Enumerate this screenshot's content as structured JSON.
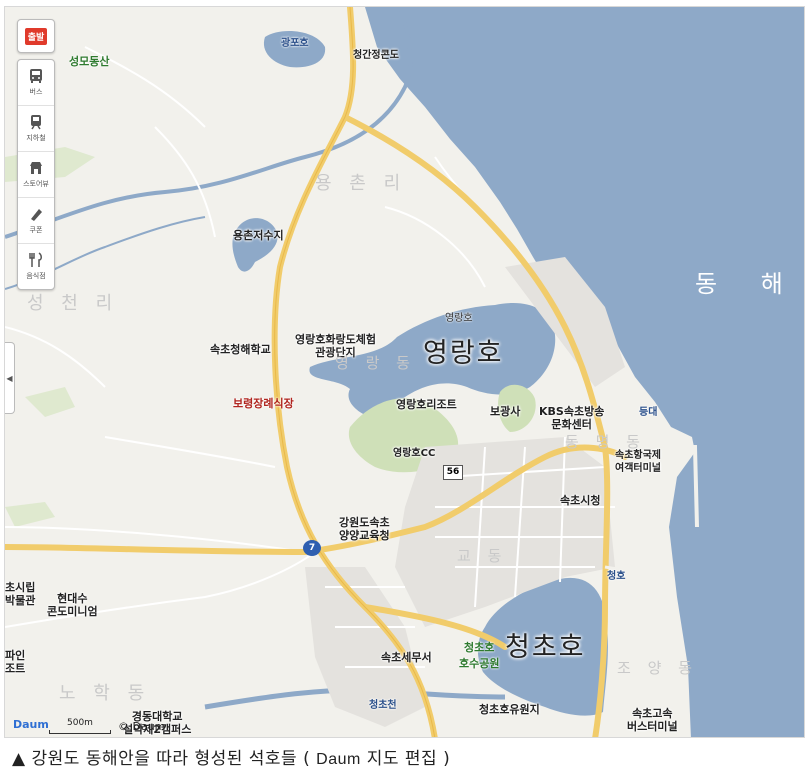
{
  "toolbar": {
    "start": "출발",
    "items": [
      {
        "label": "버스",
        "icon": "bus-icon"
      },
      {
        "label": "지하철",
        "icon": "subway-icon"
      },
      {
        "label": "스토어뷰",
        "icon": "store-icon"
      },
      {
        "label": "쿠폰",
        "icon": "coupon-icon"
      },
      {
        "label": "음식점",
        "icon": "restaurant-icon"
      }
    ],
    "collapse_arrow": "◀"
  },
  "labels": {
    "seongmo": "성모동산",
    "gwangpoho": "광포호",
    "cheonggan": "청간정콘도",
    "yongchon_ri": "용 촌 리",
    "yongchon_reservoir": "용촌저수지",
    "sea": "동 해",
    "seongcheon_ri": "성 천 리",
    "yeongrangho_small": "영랑호",
    "school": "속초청해학교",
    "yeongrangho_center": "영랑호화랑도체험\n관광단지",
    "yeongrangho_big": "영랑호",
    "yeongrang_dong": "영 랑 동",
    "funeral": "보령장례식장",
    "resort": "영랑호리조트",
    "bogwangsa": "보광사",
    "kbs": "KBS속초방송\n문화센터",
    "deungdae": "등대",
    "ferry": "속초항국제\n여객터미널",
    "cc": "영랑호CC",
    "dongmyeong": "동 명 동",
    "cityhall": "속초시청",
    "route56": "56",
    "route7": "7",
    "office_edu": "강원도속초\n양양교육청",
    "gyo_dong": "교 동",
    "cheongho": "청호",
    "library": "초시립\n박물관",
    "hyundai": "현대수\n콘도미니엄",
    "paine": "파인\n조트",
    "cheongchoho_park": "청초호\n호수공원",
    "cheongchoho": "청초호",
    "tax": "속초세무서",
    "joyang": "조 양 동",
    "nohak": "노 학 동",
    "cheongcho_stream": "청초천",
    "gyeongdong": "경동대학교\n설악제2캠퍼스",
    "kindergarten": "청초호유원지",
    "bus_terminal": "속초고속\n버스터미널"
  },
  "footer": {
    "logo": "Daum",
    "scale": "500m",
    "copyright": "© Daum"
  },
  "caption": {
    "prefix": "▲ 강원도 동해안을 따라 형성된 석호들 (",
    "source": "Daum",
    "suffix": "지도 편집 )"
  }
}
